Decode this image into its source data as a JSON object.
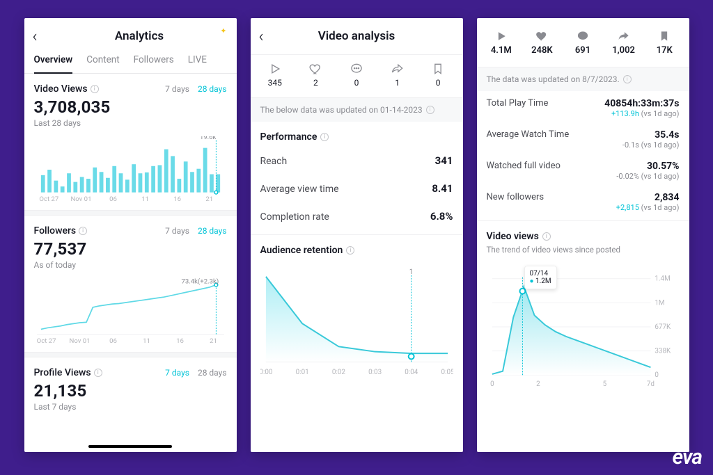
{
  "card1": {
    "title": "Analytics",
    "tabs": [
      "Overview",
      "Content",
      "Followers",
      "LIVE"
    ],
    "video_views": {
      "label": "Video Views",
      "mode1": "7 days",
      "mode2": "28 days",
      "value": "3,708,035",
      "sub": "Last 28 days",
      "marker": "19.6k",
      "axis": [
        "Oct 27",
        "Nov 01",
        "06",
        "11",
        "16",
        "21"
      ]
    },
    "followers": {
      "label": "Followers",
      "mode1": "7 days",
      "mode2": "28 days",
      "value": "77,537",
      "sub": "As of today",
      "marker": "73.4k(+2.3k)",
      "axis": [
        "Oct 27",
        "Nov 01",
        "06",
        "11",
        "16",
        "21"
      ]
    },
    "profile_views": {
      "label": "Profile Views",
      "mode1": "7 days",
      "mode2": "28 days",
      "value": "21,135",
      "sub": "Last 7 days"
    }
  },
  "card2": {
    "title": "Video analysis",
    "stats": {
      "plays": "345",
      "likes": "2",
      "comments": "0",
      "shares": "1",
      "bookmarks": "0"
    },
    "notice": "The below data was updated on 01-14-2023",
    "perf_label": "Performance",
    "reach": {
      "k": "Reach",
      "v": "341"
    },
    "avt": {
      "k": "Average view time",
      "v": "8.41"
    },
    "cr": {
      "k": "Completion rate",
      "v": "6.8%"
    },
    "retention": {
      "label": "Audience retention",
      "marker": "1",
      "axis": [
        "0:00",
        "0:01",
        "0:02",
        "0:03",
        "0:04",
        "0:05"
      ]
    }
  },
  "card3": {
    "stats": {
      "plays": "4.1M",
      "likes": "248K",
      "comments": "691",
      "shares": "1,002",
      "bookmarks": "17K"
    },
    "notice": "The data was updated on 8/7/2023.",
    "total_play": {
      "k": "Total Play Time",
      "v": "40854h:33m:37s",
      "delta": "+113.9h",
      "suf": " (vs 1d ago)"
    },
    "avg_watch": {
      "k": "Average Watch Time",
      "v": "35.4s",
      "delta": "-0.1s",
      "suf": " (vs 1d ago)"
    },
    "full": {
      "k": "Watched full video",
      "v": "30.57%",
      "delta": "-0.02%",
      "suf": " (vs 1d ago)"
    },
    "newf": {
      "k": "New followers",
      "v": "2,834",
      "delta": "+2,815",
      "suf": " (vs 1d ago)"
    },
    "views_section": {
      "title": "Video views",
      "desc": "The trend of video views since posted",
      "tooltip_date": "07/14",
      "tooltip_val": "1.2M",
      "yticks": [
        "1.4M",
        "1M",
        "677K",
        "338K",
        "0"
      ],
      "xticks": [
        "0",
        "2",
        "5",
        "7d"
      ]
    }
  },
  "logo": "eva",
  "chart_data": [
    {
      "name": "Video Views bars (card1)",
      "type": "bar",
      "categories_hint": "Oct 24 – Nov 21, daily",
      "values_relative_0_1": [
        0.38,
        0.5,
        0.26,
        0.13,
        0.42,
        0.23,
        0.34,
        0.3,
        0.55,
        0.45,
        0.32,
        0.58,
        0.42,
        0.28,
        0.62,
        0.42,
        0.44,
        0.58,
        0.6,
        0.95,
        0.8,
        0.3,
        0.68,
        0.45,
        0.52,
        0.98,
        0.4,
        0.4
      ],
      "marker": {
        "index": 27,
        "label": "19.6k"
      },
      "x_ticks": [
        "Oct 27",
        "Nov 01",
        "06",
        "11",
        "16",
        "21"
      ]
    },
    {
      "name": "Followers growth (card1)",
      "type": "line",
      "x_ticks": [
        "Oct 27",
        "Nov 01",
        "06",
        "11",
        "16",
        "21"
      ],
      "values_relative_0_1": [
        0.05,
        0.08,
        0.1,
        0.12,
        0.15,
        0.17,
        0.19,
        0.2,
        0.52,
        0.55,
        0.57,
        0.59,
        0.6,
        0.62,
        0.64,
        0.66,
        0.68,
        0.7,
        0.72,
        0.74,
        0.77,
        0.8,
        0.83,
        0.86,
        0.89,
        0.92,
        0.95,
        1.0
      ],
      "end_label": "73.4k(+2.3k)"
    },
    {
      "name": "Audience retention (card2)",
      "type": "area",
      "x": [
        "0:00",
        "0:01",
        "0:02",
        "0:03",
        "0:04",
        "0:05"
      ],
      "values_relative_0_1": [
        1.0,
        0.45,
        0.18,
        0.12,
        0.1,
        0.1
      ],
      "marker": {
        "x": "0:04",
        "label": "1"
      }
    },
    {
      "name": "Video views trend (card3)",
      "type": "area",
      "x_ticks": [
        "0",
        "2",
        "5",
        "7d"
      ],
      "y_ticks": [
        "0",
        "338K",
        "677K",
        "1M",
        "1.4M"
      ],
      "values_relative_0_1": [
        0.01,
        0.04,
        0.6,
        0.92,
        0.62,
        0.52,
        0.45,
        0.4,
        0.36,
        0.32,
        0.28,
        0.24,
        0.2,
        0.16,
        0.12,
        0.08
      ],
      "tooltip": {
        "date": "07/14",
        "value": "1.2M"
      }
    }
  ]
}
